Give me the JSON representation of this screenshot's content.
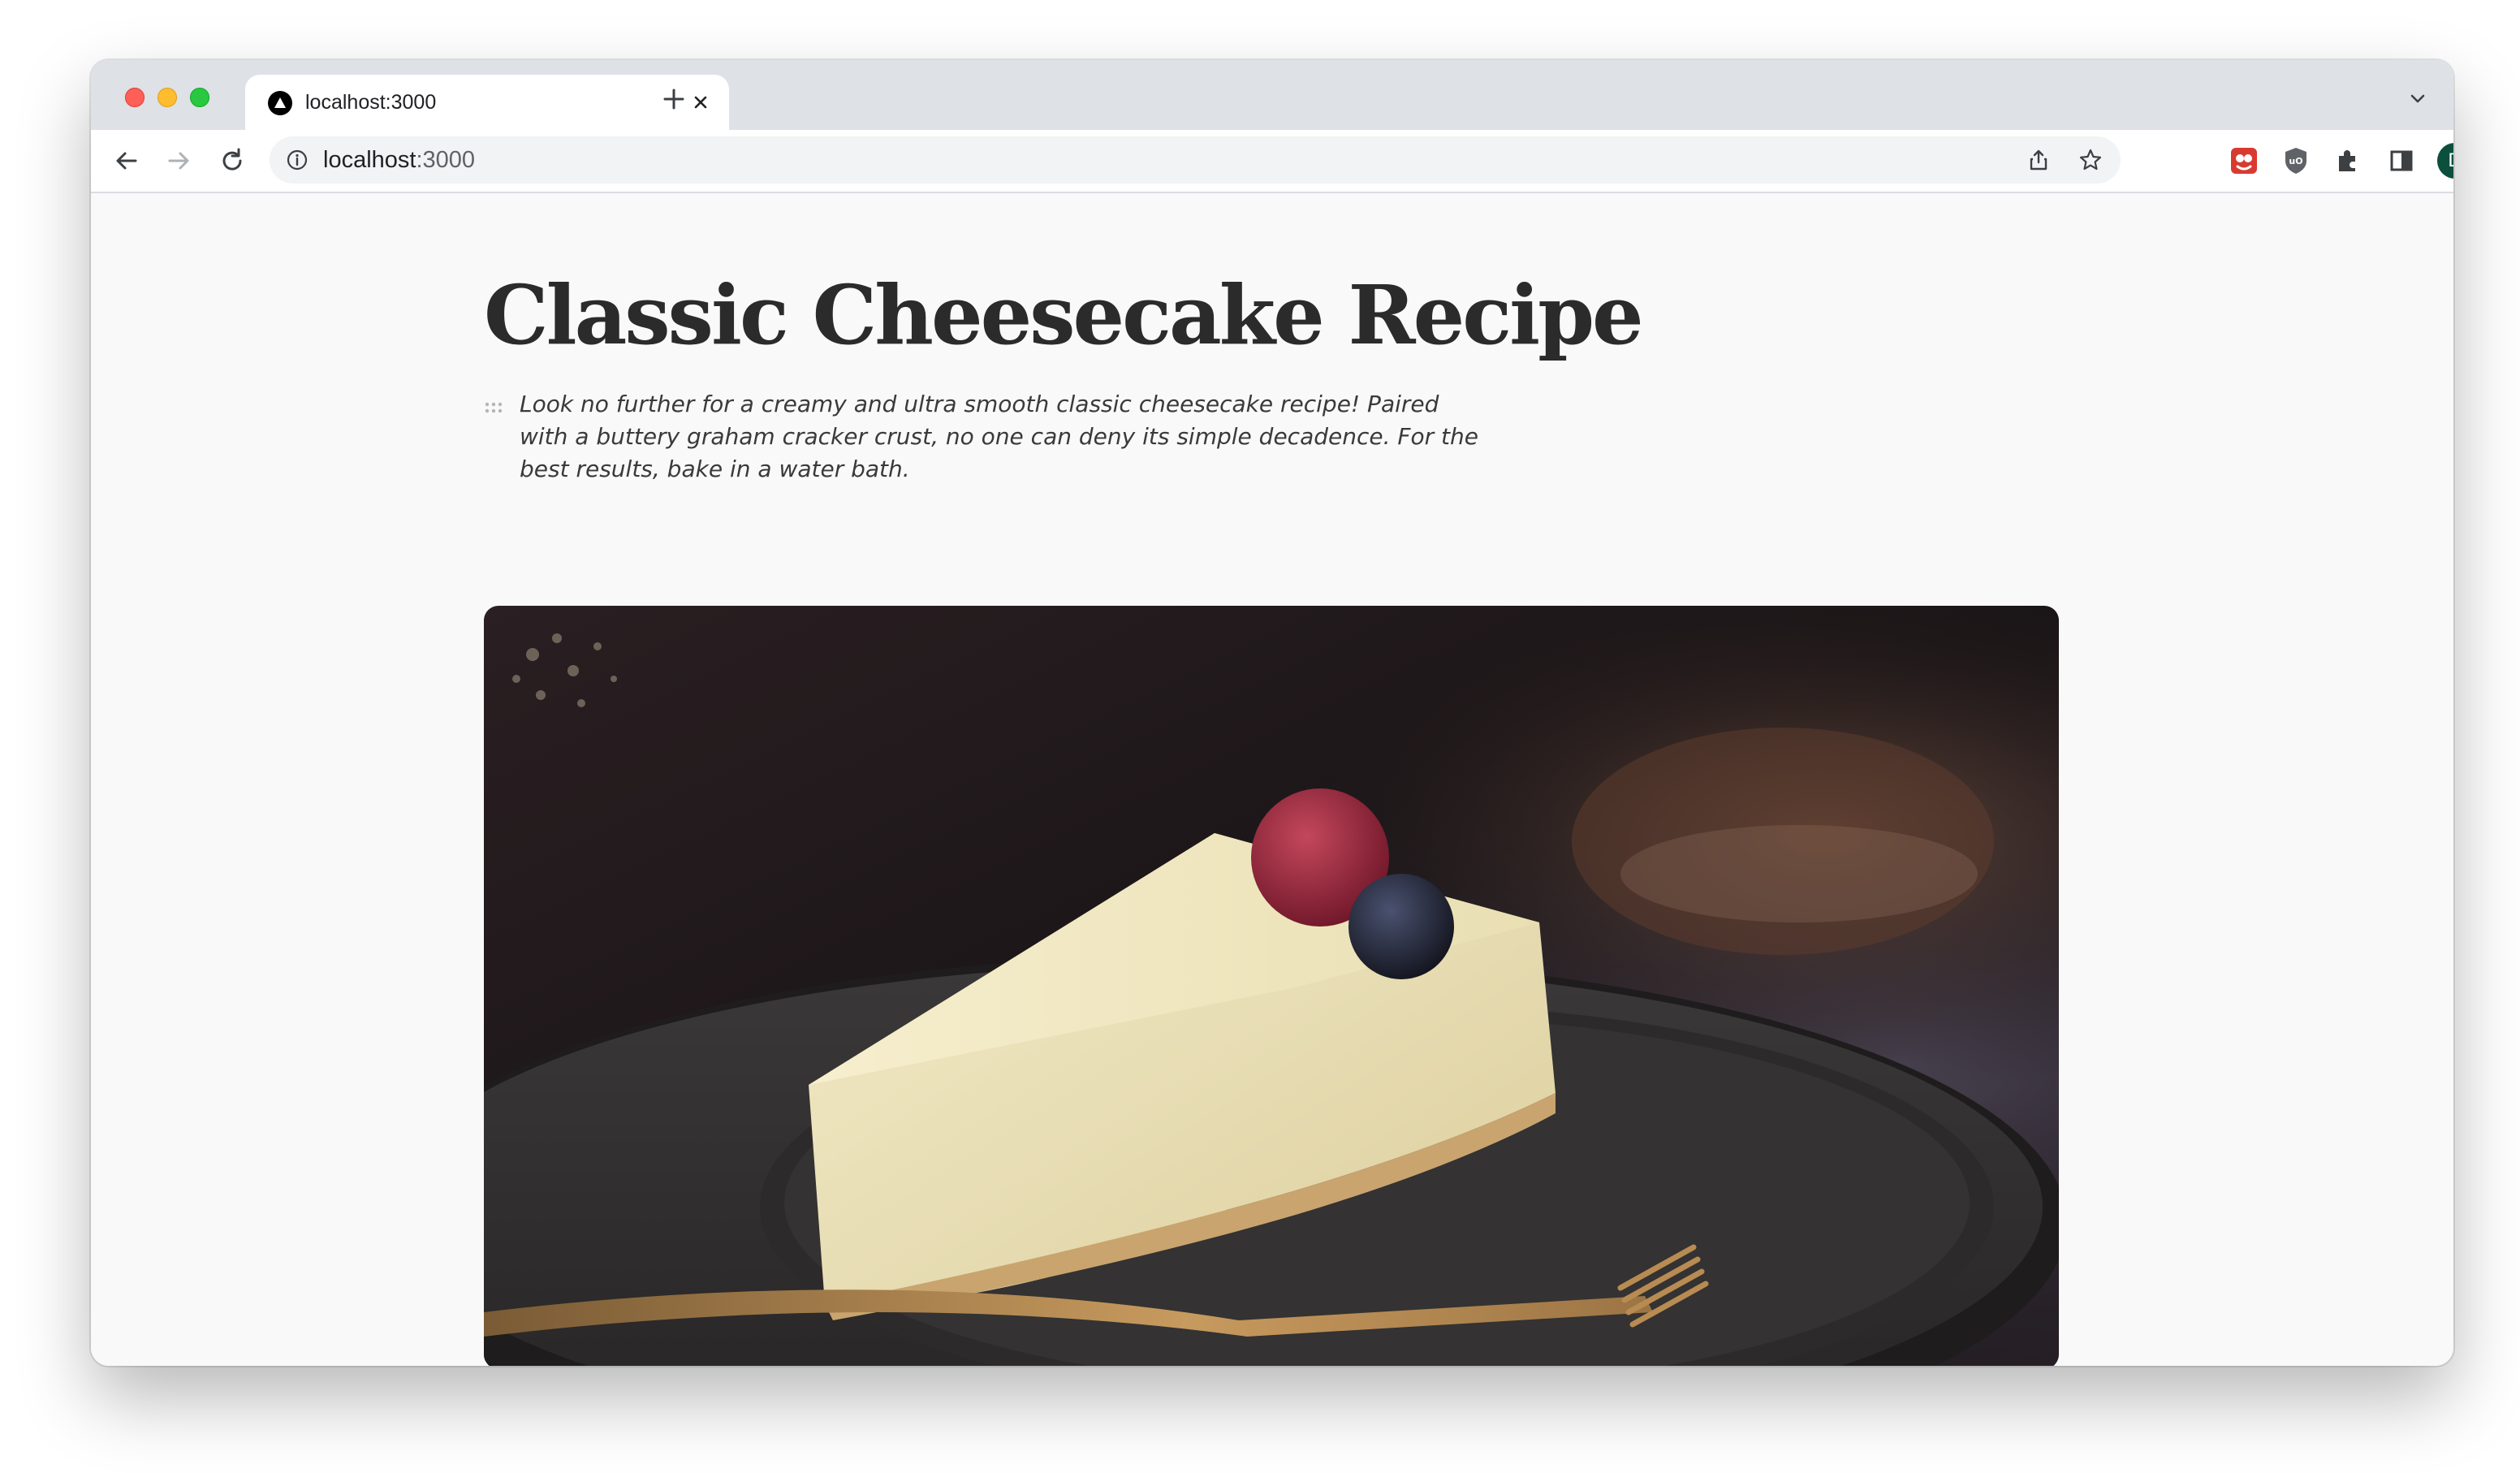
{
  "browser": {
    "tab": {
      "title": "localhost:3000"
    },
    "address": {
      "host": "localhost",
      "port": ":3000"
    },
    "profile_initial": "D"
  },
  "article": {
    "title": "Classic Cheesecake Recipe",
    "intro": "Look no further for a creamy and ultra smooth classic cheesecake recipe! Paired with a buttery graham cracker crust, no one can deny its simple decadence. For the best results, bake in a water bath."
  },
  "colors": {
    "title_text": "#2b2b2b",
    "page_background": "#f9f9f9",
    "avatar_background": "#0b4f3d"
  }
}
